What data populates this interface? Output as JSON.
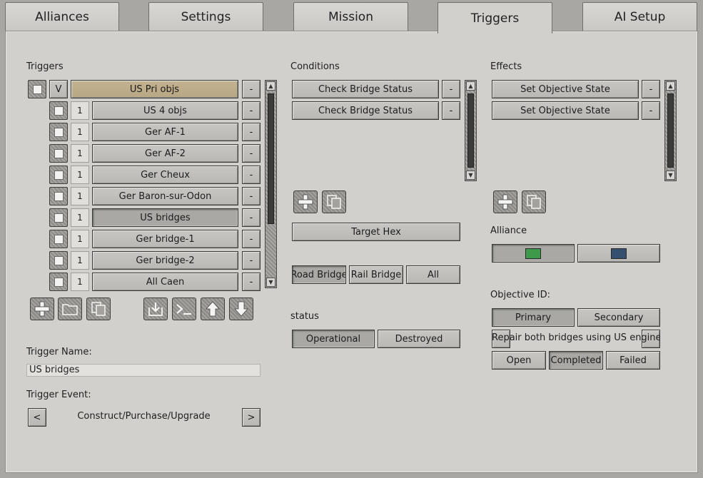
{
  "tabs": [
    "Alliances",
    "Settings",
    "Mission",
    "Triggers",
    "AI Setup"
  ],
  "triggers_section": {
    "title": "Triggers",
    "root": {
      "toggle": "V",
      "label": "US Pri objs"
    },
    "items": [
      {
        "num": "1",
        "label": "US 4 objs"
      },
      {
        "num": "1",
        "label": "Ger AF-1"
      },
      {
        "num": "1",
        "label": "Ger AF-2"
      },
      {
        "num": "1",
        "label": "Ger Cheux"
      },
      {
        "num": "1",
        "label": "Ger Baron-sur-Odon"
      },
      {
        "num": "1",
        "label": "US bridges"
      },
      {
        "num": "1",
        "label": "Ger bridge-1"
      },
      {
        "num": "1",
        "label": "Ger bridge-2"
      },
      {
        "num": "1",
        "label": "All Caen"
      }
    ],
    "remove_label": "-",
    "selected_item_index": 5
  },
  "trigger_name": {
    "label": "Trigger Name:",
    "value": "US bridges"
  },
  "trigger_event": {
    "label": "Trigger Event:",
    "prev": "<",
    "next": ">",
    "value": "Construct/Purchase/Upgrade"
  },
  "conditions": {
    "title": "Conditions",
    "items": [
      "Check Bridge Status",
      "Check Bridge Status"
    ],
    "target_hex": "Target Hex",
    "bridge_types": [
      "Road Bridge",
      "Rail Bridge",
      "All"
    ],
    "status_label": "status",
    "status_options": [
      "Operational",
      "Destroyed"
    ]
  },
  "effects": {
    "title": "Effects",
    "items": [
      "Set Objective State",
      "Set Objective State"
    ],
    "alliance_label": "Alliance",
    "alliance_colors": [
      "#3c9a4a",
      "#35506e"
    ],
    "objective_label": "Objective ID:",
    "objective_types": [
      "Primary",
      "Secondary"
    ],
    "objective_text": "Repair both bridges using US engineers",
    "objective_prev": "<",
    "objective_next": ">",
    "states": [
      "Open",
      "Completed",
      "Failed"
    ]
  },
  "icons": {
    "add": "plus-icon",
    "folder": "folder-icon",
    "copy": "copy-icon",
    "import": "import-icon",
    "console": "console-icon",
    "up": "arrow-up-icon",
    "down": "arrow-down-icon"
  }
}
